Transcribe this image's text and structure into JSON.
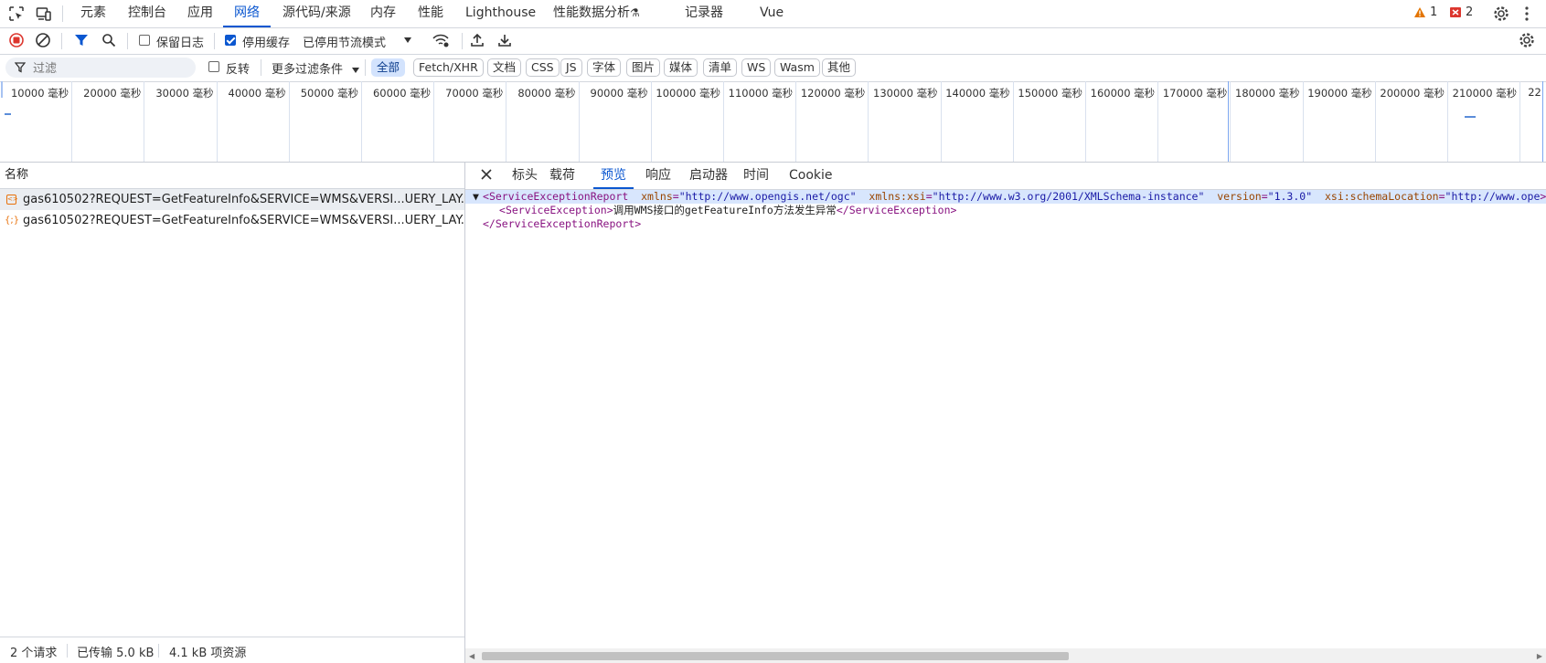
{
  "tabbar": {
    "tabs": [
      "元素",
      "控制台",
      "应用",
      "网络",
      "源代码/来源",
      "内存",
      "性能",
      "Lighthouse",
      "性能数据分析",
      "记录器",
      "Vue"
    ],
    "active_tab": "网络",
    "warnings": "1",
    "errors": "2"
  },
  "toolbar": {
    "preserve_log": "保留日志",
    "disable_cache": "停用缓存",
    "throttling": "已停用节流模式"
  },
  "filterbar": {
    "placeholder": "过滤",
    "invert": "反转",
    "more_filters": "更多过滤条件",
    "chips": [
      "全部",
      "Fetch/XHR",
      "文档",
      "CSS",
      "JS",
      "字体",
      "图片",
      "媒体",
      "清单",
      "WS",
      "Wasm",
      "其他"
    ],
    "active_chip": "全部"
  },
  "timeline": {
    "ticks": [
      "10000 毫秒",
      "20000 毫秒",
      "30000 毫秒",
      "40000 毫秒",
      "50000 毫秒",
      "60000 毫秒",
      "70000 毫秒",
      "80000 毫秒",
      "90000 毫秒",
      "100000 毫秒",
      "110000 毫秒",
      "120000 毫秒",
      "130000 毫秒",
      "140000 毫秒",
      "150000 毫秒",
      "160000 毫秒",
      "170000 毫秒",
      "180000 毫秒",
      "190000 毫秒",
      "200000 毫秒",
      "210000 毫秒",
      "22"
    ]
  },
  "requests": {
    "header": "名称",
    "items": [
      "gas610502?REQUEST=GetFeatureInfo&SERVICE=WMS&VERSI...UERY_LAY...",
      "gas610502?REQUEST=GetFeatureInfo&SERVICE=WMS&VERSI...UERY_LAY..."
    ]
  },
  "status": {
    "requests": "2 个请求",
    "transferred": "已传输 5.0 kB",
    "resources": "4.1 kB 项资源"
  },
  "detail": {
    "tabs": [
      "标头",
      "载荷",
      "预览",
      "响应",
      "启动器",
      "时间",
      "Cookie"
    ],
    "active_tab": "预览"
  },
  "xml": {
    "root_tag": "ServiceExceptionReport",
    "attrs": [
      {
        "name": "xmlns",
        "value": "\"http://www.opengis.net/ogc\""
      },
      {
        "name": "xmlns:xsi",
        "value": "\"http://www.w3.org/2001/XMLSchema-instance\""
      },
      {
        "name": "version",
        "value": "\"1.3.0\""
      },
      {
        "name": "xsi:schemaLocation",
        "value": "\"http://www.ope"
      }
    ],
    "child_tag": "ServiceException",
    "child_text": "调用WMS接口的getFeatureInfo方法发生异常"
  }
}
